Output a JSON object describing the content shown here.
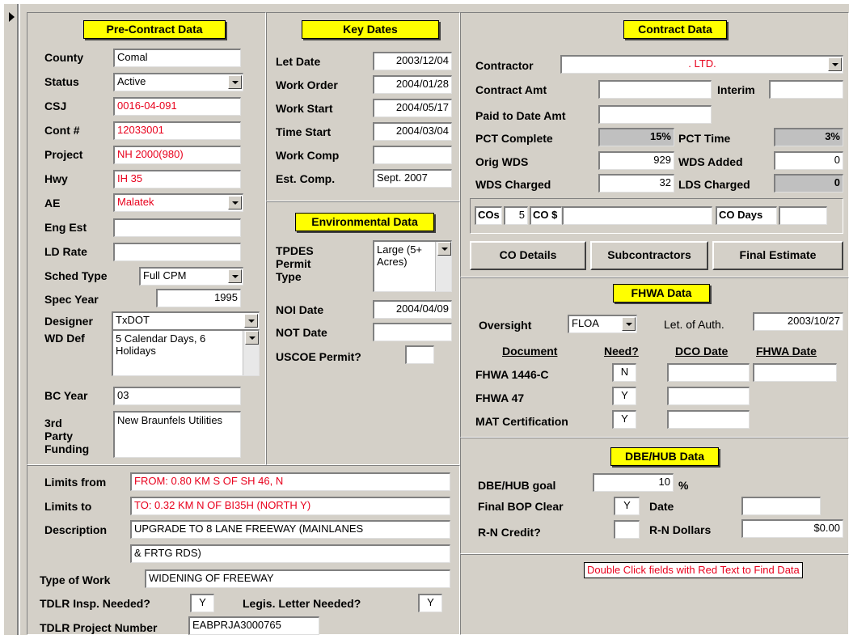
{
  "pre_contract": {
    "header": "Pre-Contract Data",
    "county_label": "County",
    "county": "Comal",
    "status_label": "Status",
    "status": "Active",
    "csj_label": "CSJ",
    "csj": "0016-04-091",
    "cont_label": "Cont #",
    "cont": "12033001",
    "project_label": "Project",
    "project": "NH 2000(980)",
    "hwy_label": "Hwy",
    "hwy": "IH 35",
    "ae_label": "AE",
    "ae": "Malatek",
    "eng_est_label": "Eng Est",
    "eng_est": "",
    "ld_rate_label": "LD Rate",
    "ld_rate": "",
    "sched_type_label": "Sched Type",
    "sched_type": "Full CPM",
    "spec_year_label": "Spec Year",
    "spec_year": "1995",
    "designer_label": "Designer",
    "designer": "TxDOT",
    "wd_def_label": "WD Def",
    "wd_def": "5 Calendar Days, 6 Holidays",
    "bc_year_label": "BC Year",
    "bc_year": "03",
    "third_party_label_1": "3rd",
    "third_party_label_2": "Party",
    "third_party_label_3": "Funding",
    "third_party": "New Braunfels Utilities"
  },
  "key_dates": {
    "header": "Key Dates",
    "let_date_label": "Let Date",
    "let_date": "2003/12/04",
    "work_order_label": "Work Order",
    "work_order": "2004/01/28",
    "work_start_label": "Work Start",
    "work_start": "2004/05/17",
    "time_start_label": "Time Start",
    "time_start": "2004/03/04",
    "work_comp_label": "Work Comp",
    "work_comp": "",
    "est_comp_label": "Est. Comp.",
    "est_comp": "Sept. 2007"
  },
  "environmental": {
    "header": "Environmental Data",
    "tpdes_label_1": "TPDES",
    "tpdes_label_2": "Permit",
    "tpdes_label_3": "Type",
    "tpdes": "Large (5+ Acres)",
    "noi_label": "NOI Date",
    "noi": "2004/04/09",
    "not_label": "NOT Date",
    "not": "",
    "uscoe_label": "USCOE Permit?",
    "uscoe": ""
  },
  "limits": {
    "from_label": "Limits from",
    "from": "FROM: 0.80 KM S OF SH 46, N",
    "to_label": "Limits to",
    "to": "TO: 0.32 KM N OF BI35H (NORTH Y)",
    "desc_label": "Description",
    "desc_1": "UPGRADE TO 8 LANE FREEWAY (MAINLANES",
    "desc_2": "& FRTG RDS)",
    "type_label": "Type of Work",
    "type": "WIDENING OF FREEWAY",
    "tdlr_insp_label": "TDLR Insp. Needed?",
    "tdlr_insp": "Y",
    "legis_label": "Legis. Letter Needed?",
    "legis": "Y",
    "tdlr_proj_label": "TDLR Project Number",
    "tdlr_proj": "EABPRJA3000765"
  },
  "contract": {
    "header": "Contract Data",
    "contractor_label": "Contractor",
    "contractor": ". LTD.",
    "amt_label": "Contract Amt",
    "amt": "",
    "interim_label": "Interim",
    "interim": "",
    "paid_label": "Paid to Date Amt",
    "paid": "",
    "pct_complete_label": "PCT Complete",
    "pct_complete": "15%",
    "pct_time_label": "PCT Time",
    "pct_time": "3%",
    "orig_wds_label": "Orig WDS",
    "orig_wds": "929",
    "wds_added_label": "WDS Added",
    "wds_added": "0",
    "wds_charged_label": "WDS Charged",
    "wds_charged": "32",
    "lds_charged_label": "LDS Charged",
    "lds_charged": "0",
    "cos_label": "COs",
    "cos": "5",
    "co_dollar_label": "CO $",
    "co_dollar": "",
    "co_days_label": "CO Days",
    "co_days": "",
    "co_details_btn": "CO Details",
    "subcontractors_btn": "Subcontractors",
    "final_estimate_btn": "Final Estimate"
  },
  "fhwa": {
    "header": "FHWA Data",
    "oversight_label": "Oversight",
    "oversight": "FLOA",
    "auth_label": "Let. of Auth.",
    "auth": "2003/10/27",
    "col_document": "Document",
    "col_need": "Need?",
    "col_dco": "DCO Date",
    "col_fhwa": "FHWA Date",
    "rows": [
      {
        "doc": "FHWA 1446-C",
        "need": "N",
        "dco": "",
        "fhwa": ""
      },
      {
        "doc": "FHWA 47",
        "need": "Y",
        "dco": ""
      },
      {
        "doc": "MAT Certification",
        "need": "Y",
        "dco": ""
      }
    ]
  },
  "dbe": {
    "header": "DBE/HUB Data",
    "goal_label": "DBE/HUB goal",
    "goal": "10",
    "goal_unit": "%",
    "bop_label": "Final BOP Clear",
    "bop": "Y",
    "date_label": "Date",
    "date": "",
    "rn_credit_label": "R-N Credit?",
    "rn_credit": "",
    "rn_dollars_label": "R-N Dollars",
    "rn_dollars": "$0.00"
  },
  "note": "Double Click fields with Red Text to Find Data",
  "colors": {
    "form_bg": "#d4d0c8",
    "header_bg": "#ffff00",
    "red_text": "#e8001c"
  }
}
